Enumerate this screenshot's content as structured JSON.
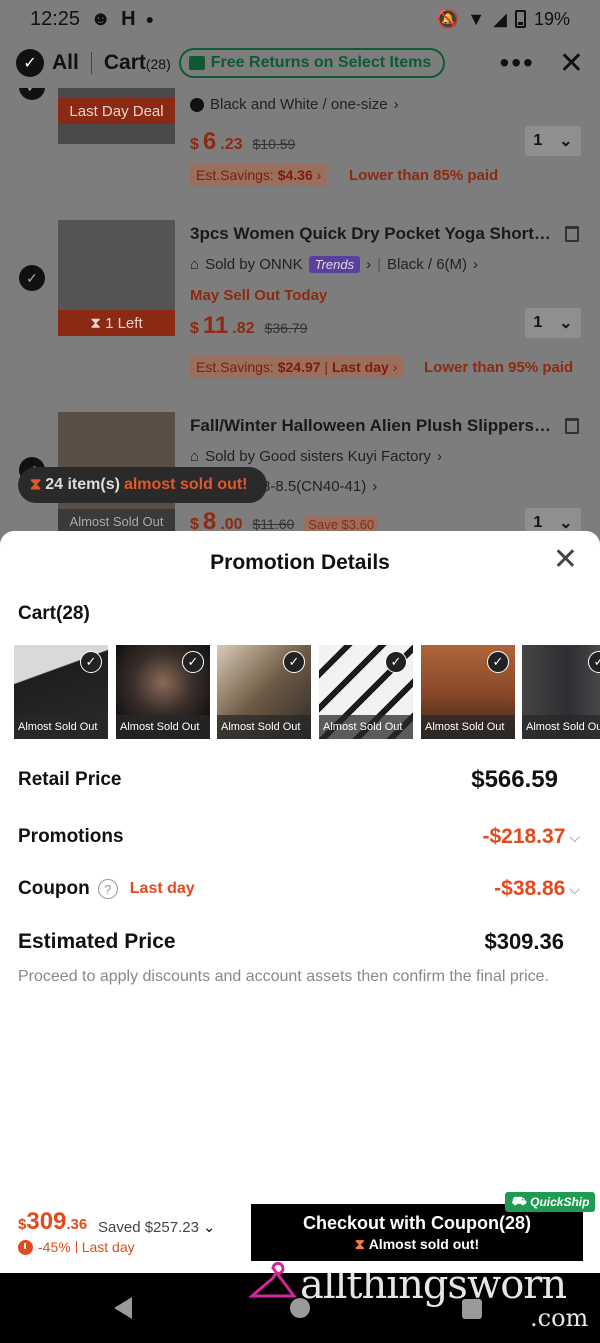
{
  "status_bar": {
    "time": "12:25",
    "battery": "19%"
  },
  "header": {
    "all_label": "All",
    "cart_label": "Cart",
    "cart_count": "(28)",
    "free_returns": "Free Returns on Select Items"
  },
  "bg_items": [
    {
      "variant": "Black and White / one-size",
      "tag": "Last Day Deal",
      "price_currency": "$",
      "price_int": "6",
      "price_cents": ".23",
      "price_orig": "$10.59",
      "qty": "1",
      "savings_label": "Est.Savings:",
      "savings_value": "$4.36",
      "lower": "Lower than 85% paid"
    },
    {
      "title": "3pcs Women Quick Dry Pocket Yoga Shorts, ...",
      "sold_by": "Sold by ONNK",
      "trends": "Trends",
      "variant": "Black / 6(M)",
      "warning": "May Sell Out Today",
      "tag": "1 Left",
      "price_currency": "$",
      "price_int": "11",
      "price_cents": ".82",
      "price_orig": "$36.79",
      "qty": "1",
      "savings_label": "Est.Savings:",
      "savings_value": "$24.97",
      "savings_extra": "Last day",
      "lower": "Lower than 95% paid"
    },
    {
      "title": "Fall/Winter Halloween Alien Plush Slippers ...",
      "sold_by": "Sold by Good sisters Kuyi Factory",
      "variant": "8-8.5(CN40-41)",
      "tag": "Almost Sold Out",
      "price_currency": "$",
      "price_int": "8",
      "price_cents": ".00",
      "price_orig": "$11.60",
      "save": "Save $3.60",
      "qty": "1"
    }
  ],
  "almost_banner": {
    "count": "24 item(s)",
    "text": "almost sold out!"
  },
  "sheet": {
    "title": "Promotion Details",
    "cart_label": "Cart(28)",
    "thumbs": [
      {
        "label": "Almost Sold Out",
        "color": "#2b2b2b"
      },
      {
        "label": "Almost Sold Out",
        "color": "#3a2f2a"
      },
      {
        "label": "Almost Sold Out",
        "color": "#6e5a44"
      },
      {
        "label": "Almost Sold Out",
        "color": "#e8e8e8"
      },
      {
        "label": "Almost Sold Out",
        "color": "#8a4a2a"
      },
      {
        "label": "Almost Sold Out",
        "color": "#2e2e33"
      }
    ],
    "retail": {
      "label": "Retail Price",
      "value": "$566.59"
    },
    "promotions": {
      "label": "Promotions",
      "value": "-$218.37"
    },
    "coupon": {
      "label": "Coupon",
      "lastday": "Last day",
      "value": "-$38.86"
    },
    "estimated": {
      "label": "Estimated Price",
      "value": "$309.36"
    },
    "note": "Proceed to apply discounts and account assets then confirm the final price."
  },
  "checkout": {
    "currency": "$",
    "total_int": "309",
    "total_cents": ".36",
    "saved": "Saved $257.23",
    "discount": "-45%",
    "lastday": "Last day",
    "button_main": "Checkout with Coupon(28)",
    "button_sub": "Almost sold out!",
    "quickship": "QuickShip"
  },
  "watermark": {
    "text": "allthingsworn",
    "sub": ".com"
  },
  "colors": {
    "accent": "#e44a1c",
    "green": "#0e5a33",
    "quickship": "#1f9b53"
  }
}
